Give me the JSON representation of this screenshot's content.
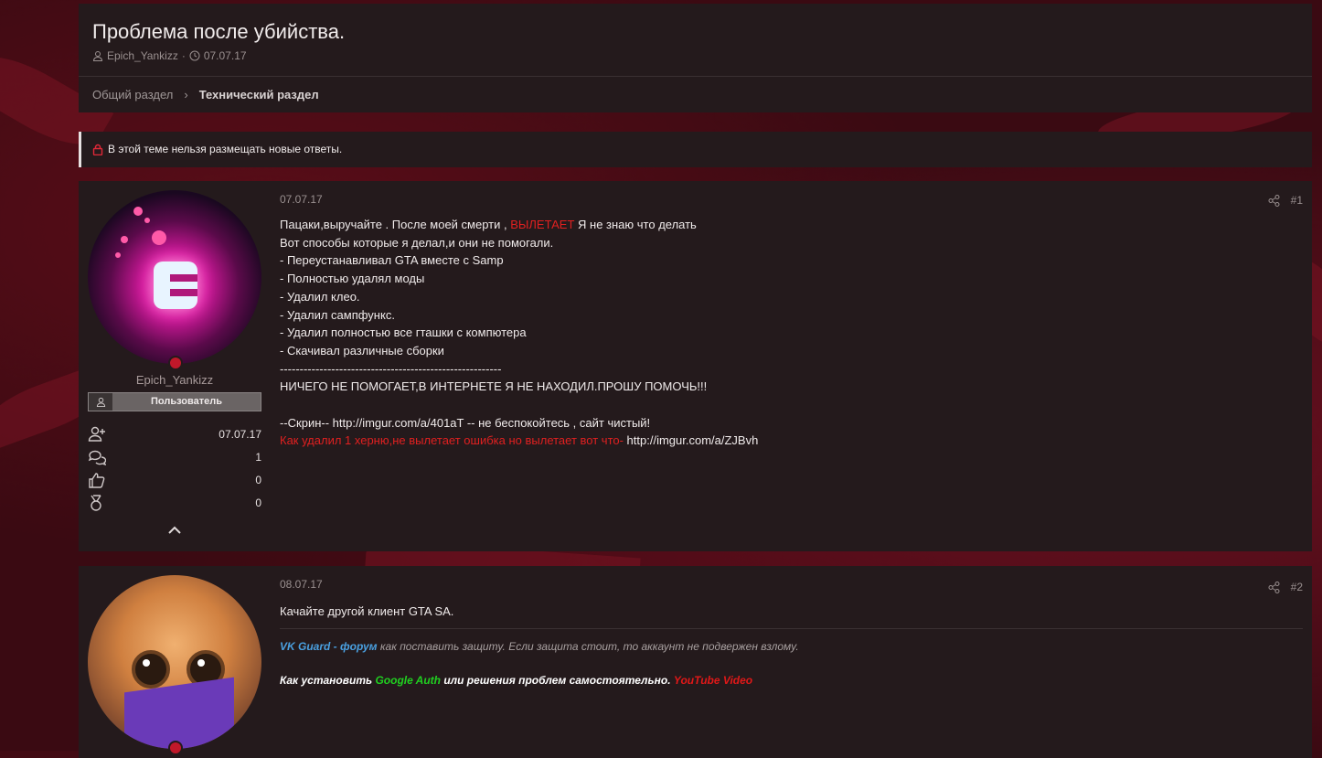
{
  "thread": {
    "title": "Проблема после убийства.",
    "author": "Epich_Yankizz",
    "date": "07.07.17"
  },
  "breadcrumb": [
    "Общий раздел",
    "Технический раздел"
  ],
  "notice": "В этой теме нельзя размещать новые ответы.",
  "posts": [
    {
      "date": "07.07.17",
      "number": "#1",
      "username": "Epich_Yankizz",
      "role": "Пользователь",
      "stats": {
        "joined": "07.07.17",
        "messages": "1",
        "reactions": "0",
        "points": "0"
      },
      "lines": [
        "Вот способы которые я делал,и они не помогали.",
        "- Переустанавливал GTA вместе с Samp",
        "- Полностью удалял моды",
        "- Удалил клео.",
        "- Удалил сампфункс.",
        "- Удалил полностью все гташки с компютера",
        "- Скачивал различные сборки",
        "--------------------------------------------------------",
        "НИЧЕГО НЕ ПОМОГАЕТ,В ИНТЕРНЕТЕ Я НЕ НАХОДИЛ.ПРОШУ ПОМОЧЬ!!!",
        "",
        "--Скрин-- http://imgur.com/a/401aT -- не беспокойтесь , сайт чистый!"
      ],
      "line1_a": "Пацаки,выручайте . После моей смерти , ",
      "line1_red": "ВЫЛЕТАЕТ",
      "line1_b": " Я не знаю что делать",
      "last_red": "Как удалил 1 херню,не вылетает ошибка но вылетает вот что- ",
      "last_link": "http://imgur.com/a/ZJBvh"
    },
    {
      "date": "08.07.17",
      "number": "#2",
      "text": "Качайте другой клиент GTA SA.",
      "sig1_blue": "VK Guard - форум",
      "sig1_rest": " как поставить защиту. Если защита стоит, то аккаунт не подвержен взлому.",
      "sig2_a": "Как установить ",
      "sig2_green": "Google Auth",
      "sig2_b": " или решения проблем самостоятельно. ",
      "sig2_red": "YouTube Video"
    }
  ],
  "colors": {
    "accent_red": "#e02020",
    "link_blue": "#4aa0e0",
    "green": "#20d020"
  },
  "icons": [
    "user-icon",
    "clock-icon",
    "chevron-right-icon",
    "lock-icon",
    "share-icon",
    "user-plus-icon",
    "messages-icon",
    "thumbs-up-icon",
    "medal-icon",
    "chevron-up-icon"
  ]
}
